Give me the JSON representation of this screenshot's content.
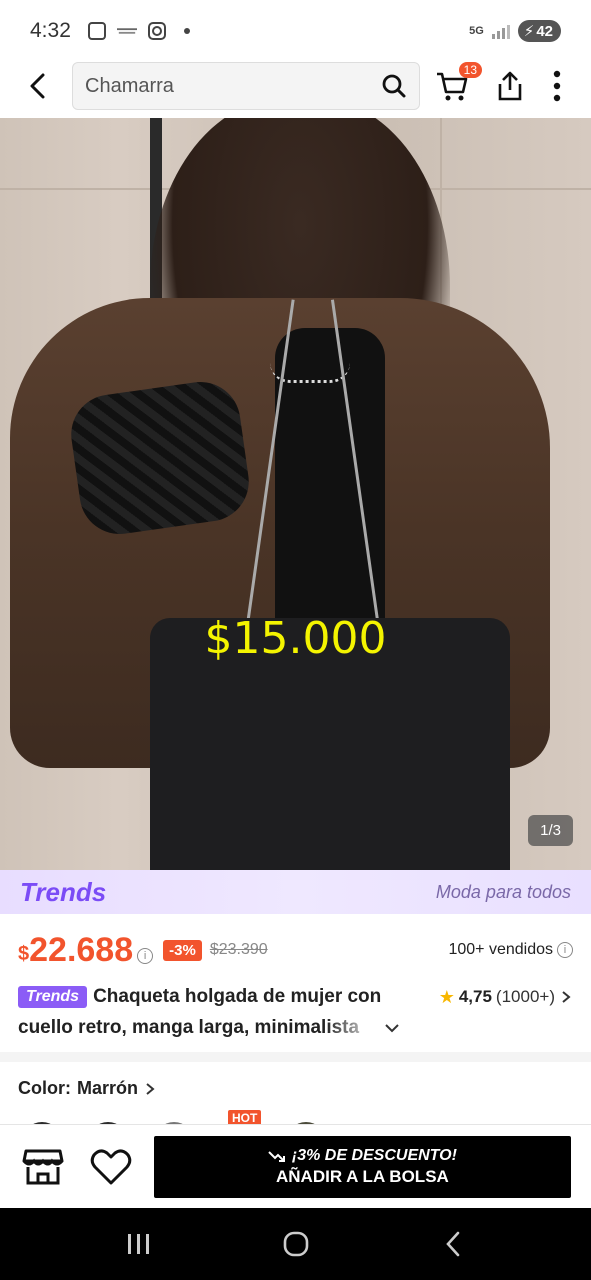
{
  "status_bar": {
    "time": "4:32",
    "network": "5G",
    "battery": "42"
  },
  "header": {
    "search_value": "Chamarra",
    "cart_count": "13"
  },
  "product_image": {
    "overlay_price": "$15.000",
    "page_indicator": "1/3"
  },
  "trends_banner": {
    "logo": "Trends",
    "tagline": "Moda para todos"
  },
  "price": {
    "currency": "$",
    "current": "22.688",
    "discount": "-3%",
    "original": "$23.390",
    "sold": "100+ vendidos"
  },
  "title": {
    "tag": "Trends",
    "line1": "Chaqueta holgada de mujer con",
    "line2": "cuello retro, manga larga, minimalista",
    "rating": "4,75",
    "rating_count": "(1000+)"
  },
  "color": {
    "label": "Color:",
    "value": "Marrón",
    "hot_tag": "HOT"
  },
  "action_bar": {
    "promo": "¡3% DE DESCUENTO!",
    "add_label": "AÑADIR A LA BOLSA"
  }
}
